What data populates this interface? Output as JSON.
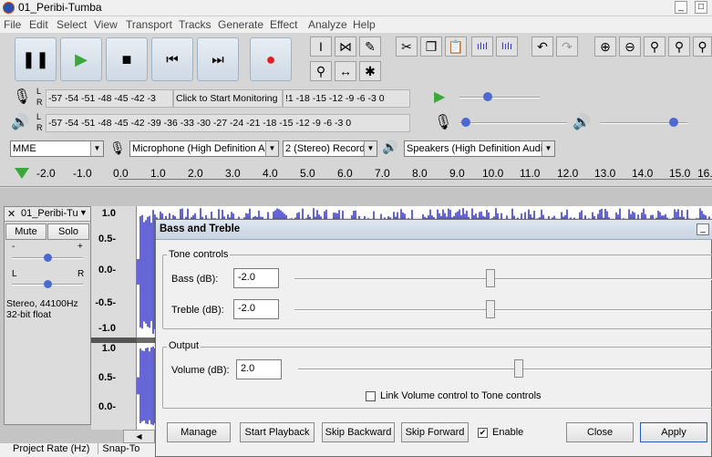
{
  "window": {
    "title": "01_Peribi-Tumba",
    "controls": [
      "_",
      "□"
    ]
  },
  "menu": [
    "File",
    "Edit",
    "Select",
    "View",
    "Transport",
    "Tracks",
    "Generate",
    "Effect",
    "Analyze",
    "Help"
  ],
  "transport": {
    "pause": "❚❚",
    "play": "▶",
    "stop": "■",
    "skip_start": "⏮",
    "skip_end": "⏭",
    "record": "●"
  },
  "record_meter": {
    "channels": [
      "L",
      "R"
    ],
    "scale": "-57 -54 -51 -48 -45 -42 -3",
    "monitor": "Click to Start Monitoring",
    "scale_end": "!1 -18 -15 -12 -9 -6 -3 0"
  },
  "play_meter": {
    "channels": [
      "L",
      "R"
    ],
    "scale": "-57 -54 -51 -48 -45 -42 -39 -36 -33 -30 -27 -24 -21 -18 -15 -12 -9 -6 -3 0"
  },
  "device": {
    "host": "MME",
    "input": "Microphone (High Definition Au",
    "channels": "2 (Stereo) Record",
    "output": "Speakers (High Definition Audio"
  },
  "ruler": [
    "-2.0",
    "-1.0",
    "0.0",
    "1.0",
    "2.0",
    "3.0",
    "4.0",
    "5.0",
    "6.0",
    "7.0",
    "8.0",
    "9.0",
    "10.0",
    "11.0",
    "12.0",
    "13.0",
    "14.0",
    "15.0",
    "16."
  ],
  "track": {
    "name": "01_Peribi-Tu",
    "mute": "Mute",
    "solo": "Solo",
    "gain_minus": "-",
    "gain_plus": "+",
    "pan_left": "L",
    "pan_right": "R",
    "format_rate": "Stereo, 44100Hz",
    "format_depth": "32-bit float",
    "axis_upper": [
      "1.0",
      "0.5-",
      "0.0-",
      "-0.5-",
      "-1.0"
    ],
    "axis_lower": [
      "1.0",
      "0.5-",
      "0.0-"
    ]
  },
  "dialog": {
    "title": "Bass and Treble",
    "tone_group": "Tone controls",
    "bass_label": "Bass (dB):",
    "bass_value": "-2.0",
    "treble_label": "Treble (dB):",
    "treble_value": "-2.0",
    "output_group": "Output",
    "volume_label": "Volume (dB):",
    "volume_value": "2.0",
    "link_label": "Link Volume control to Tone controls",
    "link_checked": false,
    "buttons": {
      "manage": "Manage",
      "start_playback": "Start Playback",
      "skip_backward": "Skip Backward",
      "skip_forward": "Skip Forward",
      "enable": "Enable",
      "close": "Close",
      "apply": "Apply"
    },
    "enable_checked": true
  },
  "status": {
    "project_rate": "Project Rate (Hz)",
    "snap": "Snap-To"
  },
  "colors": {
    "waveform": "#3232c8",
    "record": "#e02020",
    "play": "#3ca83c",
    "selection": "#c8c8dc"
  }
}
